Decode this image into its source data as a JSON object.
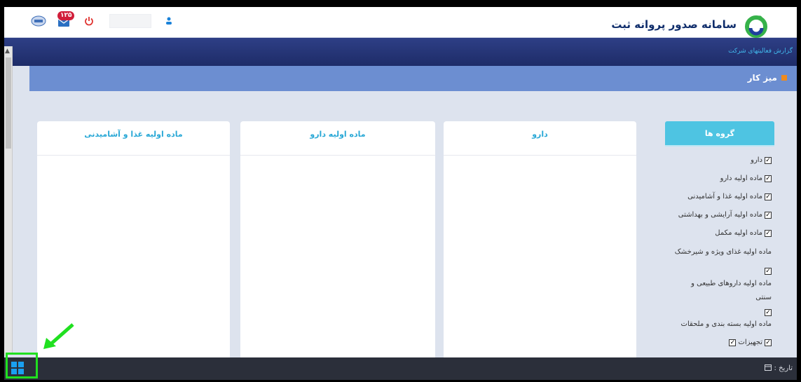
{
  "header": {
    "site_title": "سامانه صدور پروانه ثبت",
    "notification_count": "۱۲۵",
    "brand_color": "#0f2d6b"
  },
  "nav": {
    "report_link": "گزارش فعالیتهای شرکت"
  },
  "workspace": {
    "title": "میز کار"
  },
  "groups": {
    "title": "گروه ها",
    "items": [
      {
        "label": "دارو",
        "checked": true
      },
      {
        "label": "ماده اولیه دارو",
        "checked": true
      },
      {
        "label": "ماده اولیه غذا و آشامیدنی",
        "checked": true
      },
      {
        "label": "ماده اولیه آرایشی و بهداشتی",
        "checked": true
      },
      {
        "label": "ماده اولیه مکمل",
        "checked": true
      },
      {
        "label": "ماده اولیه غذای ویژه و شیرخشک",
        "checked": true
      },
      {
        "label": "ماده اولیه داروهای طبیعی و سنتی",
        "checked": true
      },
      {
        "label": "ماده اولیه بسته بندی و ملحقات",
        "checked": true
      },
      {
        "label": "تجهیزات",
        "checked": true
      }
    ]
  },
  "panels": [
    {
      "title": "دارو"
    },
    {
      "title": "ماده اولیه دارو"
    },
    {
      "title": "ماده اولیه غذا و آشامیدنی"
    }
  ],
  "footer": {
    "date_label": "تاریخ :"
  },
  "colors": {
    "accent": "#4ec4e2",
    "header_band": "#6c8ed1",
    "nav_band": "#1e2c68",
    "badge": "#d11e3a",
    "highlight": "#20e020"
  }
}
